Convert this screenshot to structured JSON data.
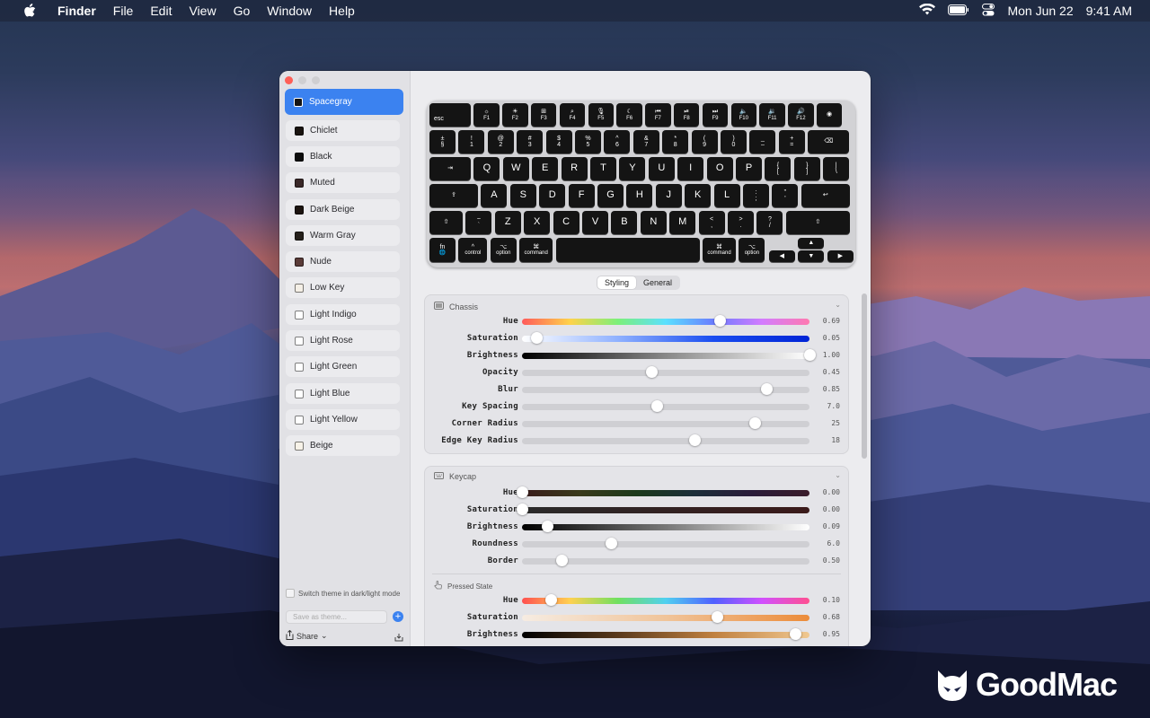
{
  "menubar": {
    "app_name": "Finder",
    "menus": [
      "File",
      "Edit",
      "View",
      "Go",
      "Window",
      "Help"
    ],
    "date": "Mon Jun 22",
    "time": "9:41 AM"
  },
  "sidebar": {
    "themes": [
      {
        "label": "Spacegray",
        "swatch": "#141414",
        "selected": true
      },
      {
        "label": "Chiclet",
        "swatch": "#1a1410"
      },
      {
        "label": "Black",
        "swatch": "#0c0c0c"
      },
      {
        "label": "Muted",
        "swatch": "#3a2828"
      },
      {
        "label": "Dark Beige",
        "swatch": "#1c1410"
      },
      {
        "label": "Warm Gray",
        "swatch": "#25201b"
      },
      {
        "label": "Nude",
        "swatch": "#5a3b38"
      },
      {
        "label": "Low Key",
        "swatch": "#f4efe6"
      },
      {
        "label": "Light Indigo",
        "swatch": "#ffffff"
      },
      {
        "label": "Light Rose",
        "swatch": "#ffffff"
      },
      {
        "label": "Light Green",
        "swatch": "#ffffff"
      },
      {
        "label": "Light Blue",
        "swatch": "#ffffff"
      },
      {
        "label": "Light Yellow",
        "swatch": "#ffffff"
      },
      {
        "label": "Beige",
        "swatch": "#f7f2e8"
      }
    ],
    "switch_label": "Switch theme in dark/light mode",
    "save_placeholder": "Save as theme...",
    "share_label": "Share"
  },
  "keyboard": {
    "fn_row": [
      {
        "top": "",
        "label": "esc"
      },
      {
        "top": "☼",
        "label": "F1"
      },
      {
        "top": "☀",
        "label": "F2"
      },
      {
        "top": "⊞",
        "label": "F3"
      },
      {
        "top": "⌕",
        "label": "F4"
      },
      {
        "top": "🎙",
        "label": "F5"
      },
      {
        "top": "☾",
        "label": "F6"
      },
      {
        "top": "⏮",
        "label": "F7"
      },
      {
        "top": "⏯",
        "label": "F8"
      },
      {
        "top": "⏭",
        "label": "F9"
      },
      {
        "top": "🔈",
        "label": "F10"
      },
      {
        "top": "🔉",
        "label": "F11"
      },
      {
        "top": "🔊",
        "label": "F12"
      },
      {
        "top": "◉",
        "label": ""
      }
    ],
    "row1": [
      [
        "±",
        "§"
      ],
      [
        "!",
        "1"
      ],
      [
        "@",
        "2"
      ],
      [
        "#",
        "3"
      ],
      [
        "$",
        "4"
      ],
      [
        "%",
        "5"
      ],
      [
        "^",
        "6"
      ],
      [
        "&",
        "7"
      ],
      [
        "*",
        "8"
      ],
      [
        "(",
        "9"
      ],
      [
        ")",
        "0"
      ],
      [
        "_",
        "–"
      ],
      [
        "+",
        "="
      ],
      [
        "",
        "⌫"
      ]
    ],
    "row2": [
      "⇥",
      "Q",
      "W",
      "E",
      "R",
      "T",
      "Y",
      "U",
      "I",
      "O",
      "P",
      [
        "{",
        "["
      ],
      [
        "}",
        "]"
      ],
      [
        "|",
        "\\"
      ]
    ],
    "row3": [
      "⇪",
      "A",
      "S",
      "D",
      "F",
      "G",
      "H",
      "J",
      "K",
      "L",
      [
        ":",
        ";"
      ],
      [
        "\"",
        "'"
      ],
      "↩"
    ],
    "row4": [
      "⇧",
      [
        "~",
        "`"
      ],
      "Z",
      "X",
      "C",
      "V",
      "B",
      "N",
      "M",
      [
        "<",
        ","
      ],
      [
        ">",
        "."
      ],
      [
        "?",
        "/"
      ],
      "⇧"
    ],
    "row5": [
      [
        "fn",
        "🌐"
      ],
      [
        "^",
        "control"
      ],
      [
        "⌥",
        "option"
      ],
      [
        "⌘",
        "command"
      ],
      "",
      [
        "⌘",
        "command"
      ],
      [
        "⌥",
        "option"
      ]
    ],
    "arrows": [
      "▲",
      "◀",
      "▼",
      "▶"
    ]
  },
  "tabs": {
    "styling": "Styling",
    "general": "General"
  },
  "chassis": {
    "title": "Chassis",
    "rows": [
      {
        "label": "Hue",
        "value": "0.69"
      },
      {
        "label": "Saturation",
        "value": "0.05"
      },
      {
        "label": "Brightness",
        "value": "1.00"
      },
      {
        "label": "Opacity",
        "value": "0.45"
      },
      {
        "label": "Blur",
        "value": "0.85"
      },
      {
        "label": "Key Spacing",
        "value": "7.0"
      },
      {
        "label": "Corner Radius",
        "value": "25"
      },
      {
        "label": "Edge Key Radius",
        "value": "18"
      }
    ]
  },
  "keycap": {
    "title": "Keycap",
    "rows": [
      {
        "label": "Hue",
        "value": "0.00"
      },
      {
        "label": "Saturation",
        "value": "0.00"
      },
      {
        "label": "Brightness",
        "value": "0.09"
      },
      {
        "label": "Roundness",
        "value": "6.0"
      },
      {
        "label": "Border",
        "value": "0.50"
      }
    ],
    "pressed_title": "Pressed State",
    "pressed_rows": [
      {
        "label": "Hue",
        "value": "0.10"
      },
      {
        "label": "Saturation",
        "value": "0.68"
      },
      {
        "label": "Brightness",
        "value": "0.95"
      }
    ]
  },
  "slider_positions": {
    "chassis": [
      0.69,
      0.05,
      1.0,
      0.45,
      0.85,
      0.47,
      0.81,
      0.6
    ],
    "keycap": [
      0.0,
      0.0,
      0.09,
      0.31,
      0.14
    ],
    "pressed": [
      0.1,
      0.68,
      0.95
    ]
  },
  "brand": {
    "name": "GoodMac"
  },
  "colors": {
    "accent": "#3b82f0",
    "keycap": "#141414"
  }
}
